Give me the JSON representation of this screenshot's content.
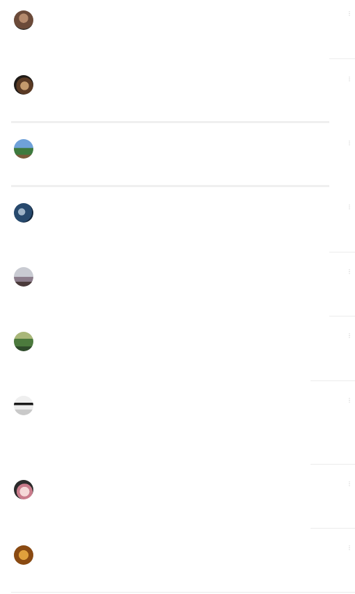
{
  "more_icon": "⋮",
  "comments": [
    {
      "name": "",
      "time": "",
      "text": "",
      "reply": "",
      "avatar_colors": [
        "#6b4a39",
        "#b58a6d",
        "#2d2a28"
      ]
    },
    {
      "name": "",
      "time": "",
      "text": "",
      "reply": "",
      "avatar_colors": [
        "#1f1b18",
        "#c49a6c",
        "#5a3a24"
      ]
    },
    {
      "name": "",
      "time": "",
      "text": "",
      "reply": "",
      "avatar_colors": [
        "#6fa1d9",
        "#3e7a3e",
        "#7a5a3a"
      ]
    },
    {
      "name": "",
      "time": "",
      "text": "",
      "reply": "",
      "avatar_colors": [
        "#27496d",
        "#9fb4c8",
        "#13263c"
      ]
    },
    {
      "name": "",
      "time": "",
      "text": "",
      "reply": "",
      "avatar_colors": [
        "#c9cbd2",
        "#8b7c8a",
        "#4a3a3a"
      ]
    },
    {
      "name": "",
      "time": "",
      "text": "",
      "reply": "",
      "avatar_colors": [
        "#4c7a3d",
        "#a9b779",
        "#2f4b2b"
      ]
    },
    {
      "name": "",
      "time": "",
      "text": "",
      "reply": "",
      "tag": "",
      "extra": "",
      "avatar_colors": [
        "#efefef",
        "#1b1b1b",
        "#c9c9c9"
      ]
    },
    {
      "name": "",
      "time": "",
      "text": "",
      "reply": "",
      "avatar_colors": [
        "#f5d8d8",
        "#2b2b2b",
        "#c97b8b"
      ]
    },
    {
      "name": "",
      "time": "",
      "text": "",
      "reply": "",
      "avatar_colors": [
        "#e0a03c",
        "#8a4a12",
        "#3b2410"
      ]
    }
  ]
}
